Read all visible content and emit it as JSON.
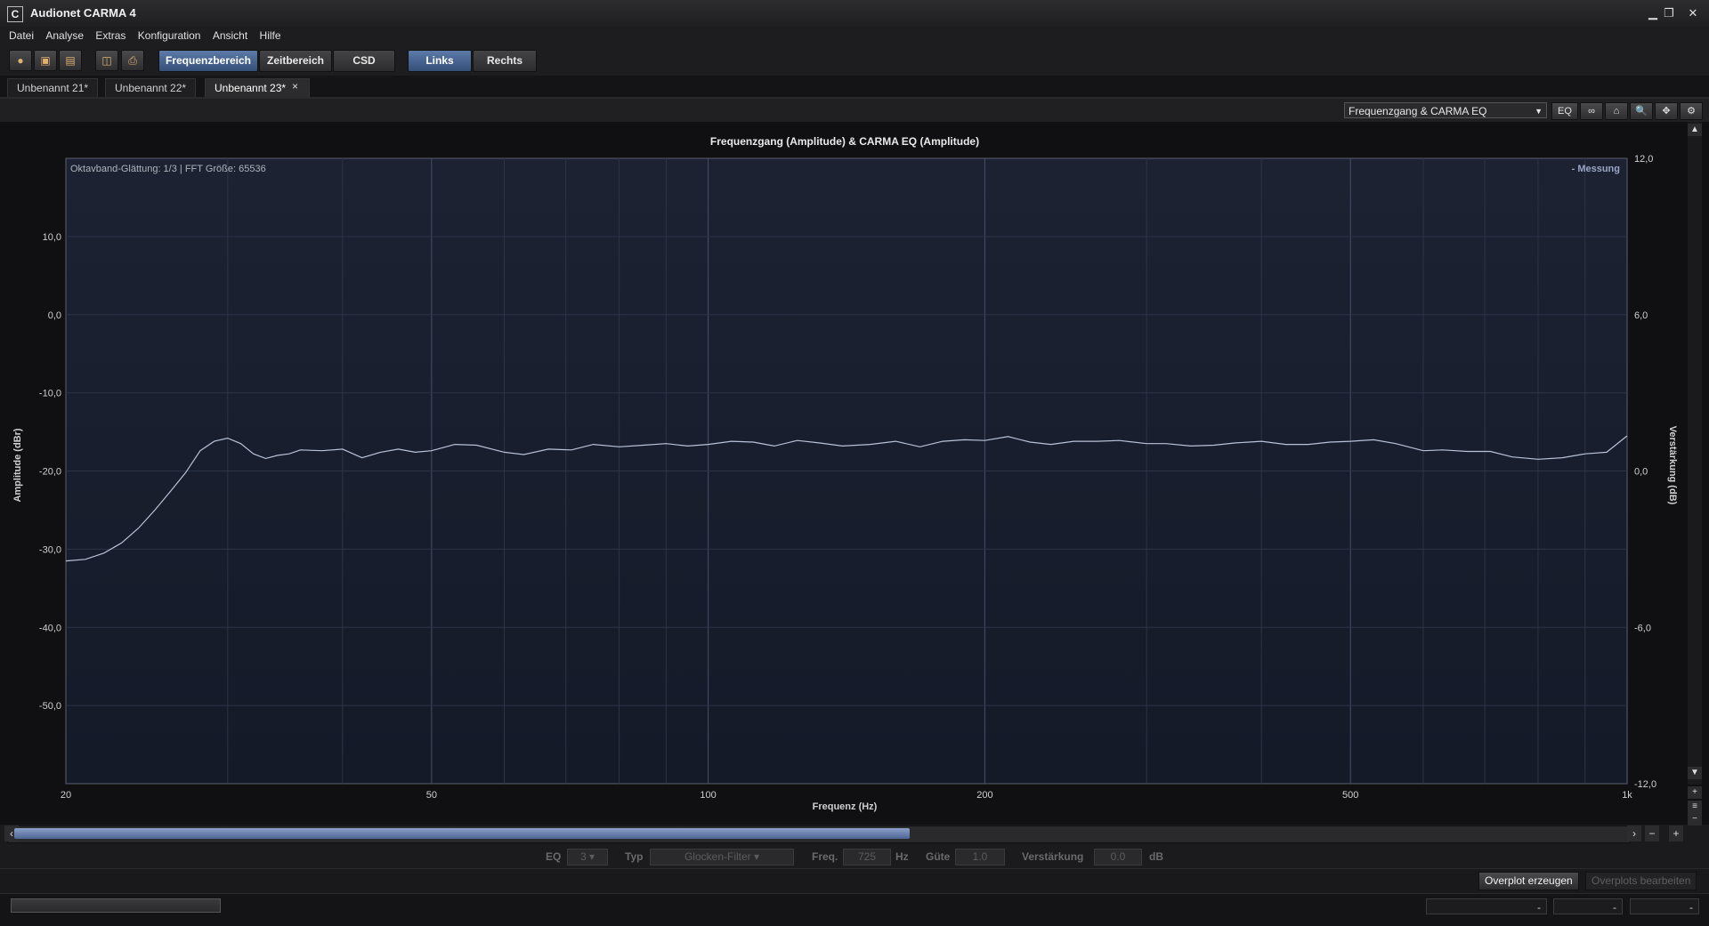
{
  "window": {
    "title": "Audionet CARMA 4",
    "icon": "C",
    "minimize": "▁",
    "restore": "❐",
    "close": "✕"
  },
  "menu": [
    "Datei",
    "Analyse",
    "Extras",
    "Konfiguration",
    "Ansicht",
    "Hilfe"
  ],
  "toolbar": {
    "icons": [
      "record-icon",
      "open-folder-icon",
      "save-icon",
      "screenshot-icon",
      "print-icon"
    ],
    "icon_glyphs": [
      "●",
      "▣",
      "▤",
      "◫",
      "⎙"
    ],
    "mode_tabs": [
      {
        "label": "Frequenzbereich",
        "active": true
      },
      {
        "label": "Zeitbereich",
        "active": false
      },
      {
        "label": "CSD",
        "active": false
      }
    ],
    "channel_tabs": [
      {
        "label": "Links",
        "active": true
      },
      {
        "label": "Rechts",
        "active": false
      }
    ]
  },
  "doc_tabs": [
    {
      "label": "Unbenannt 21*",
      "active": false
    },
    {
      "label": "Unbenannt 22*",
      "active": false
    },
    {
      "label": "Unbenannt 23*",
      "active": true,
      "close": "×"
    }
  ],
  "plot_header": {
    "view_select": "Frequenzgang & CARMA EQ",
    "eq_button": "EQ",
    "link_icon": "∞",
    "home_icon": "⌂",
    "zoom_icon": "🔍",
    "pan_icon": "✥",
    "settings_icon": "⚙"
  },
  "chart_data": {
    "type": "line",
    "title": "Frequenzgang (Amplitude) & CARMA EQ (Amplitude)",
    "annotation": "Oktavband-Glättung: 1/3 | FFT Größe: 65536",
    "legend": "- Messung",
    "legend_position": "top-right",
    "xlabel": "Frequenz (Hz)",
    "ylabel": "Amplitude (dBr)",
    "y2label": "Verstärkung (dB)",
    "x_scale": "log",
    "xlim": [
      20,
      1000
    ],
    "ylim": [
      -60,
      20
    ],
    "y2lim": [
      -12,
      12
    ],
    "grid": true,
    "x_ticks": [
      20,
      50,
      100,
      200,
      500,
      1000
    ],
    "x_tick_labels": [
      "20",
      "50",
      "100",
      "200",
      "500",
      "1k"
    ],
    "y_ticks": [
      10,
      0,
      -10,
      -20,
      -30,
      -40,
      -50
    ],
    "y_tick_labels": [
      "10,0",
      "0,0",
      "-10,0",
      "-20,0",
      "-30,0",
      "-40,0",
      "-50,0"
    ],
    "y2_ticks": [
      12,
      6,
      0,
      -6,
      -12
    ],
    "y2_tick_labels": [
      "12,0",
      "6,0",
      "0,0",
      "-6,0",
      "-12,0"
    ],
    "series": [
      {
        "name": "Messung",
        "x": [
          20,
          21,
          22,
          23,
          24,
          25,
          26,
          27,
          28,
          29,
          30,
          31,
          32,
          33,
          34,
          35,
          36,
          38,
          40,
          42,
          44,
          46,
          48,
          50,
          53,
          56,
          60,
          63,
          67,
          71,
          75,
          80,
          85,
          90,
          95,
          100,
          106,
          112,
          118,
          125,
          132,
          140,
          150,
          160,
          170,
          180,
          190,
          200,
          212,
          224,
          236,
          250,
          265,
          280,
          300,
          315,
          335,
          355,
          375,
          400,
          425,
          450,
          475,
          500,
          530,
          560,
          600,
          630,
          670,
          710,
          750,
          800,
          850,
          900,
          950,
          1000
        ],
        "y": [
          -31.5,
          -31.3,
          -30.5,
          -29.2,
          -27.3,
          -25.0,
          -22.6,
          -20.2,
          -17.4,
          -16.2,
          -15.8,
          -16.5,
          -17.8,
          -18.4,
          -18.0,
          -17.8,
          -17.3,
          -17.4,
          -17.2,
          -18.3,
          -17.6,
          -17.2,
          -17.6,
          -17.4,
          -16.6,
          -16.7,
          -17.6,
          -17.9,
          -17.2,
          -17.3,
          -16.6,
          -16.9,
          -16.7,
          -16.5,
          -16.8,
          -16.6,
          -16.2,
          -16.3,
          -16.8,
          -16.1,
          -16.4,
          -16.8,
          -16.6,
          -16.2,
          -16.9,
          -16.2,
          -16.0,
          -16.1,
          -15.6,
          -16.3,
          -16.6,
          -16.2,
          -16.2,
          -16.1,
          -16.5,
          -16.5,
          -16.8,
          -16.7,
          -16.4,
          -16.2,
          -16.6,
          -16.6,
          -16.3,
          -16.2,
          -16.0,
          -16.5,
          -17.4,
          -17.3,
          -17.5,
          -17.5,
          -18.2,
          -18.5,
          -18.3,
          -17.8,
          -17.6,
          -15.5
        ]
      }
    ]
  },
  "eq_row": {
    "eq_label": "EQ",
    "eq_value": "3",
    "typ_label": "Typ",
    "typ_value": "Glocken-Filter",
    "freq_label": "Freq.",
    "freq_value": "725",
    "freq_unit": "Hz",
    "guete_label": "Güte",
    "guete_value": "1.0",
    "gain_label": "Verstärkung",
    "gain_value": "0.0",
    "gain_unit": "dB"
  },
  "bottom_buttons": {
    "overplot_create": "Overplot erzeugen",
    "overplot_edit": "Overplots bearbeiten"
  },
  "status": [
    "-",
    "-",
    "-"
  ]
}
